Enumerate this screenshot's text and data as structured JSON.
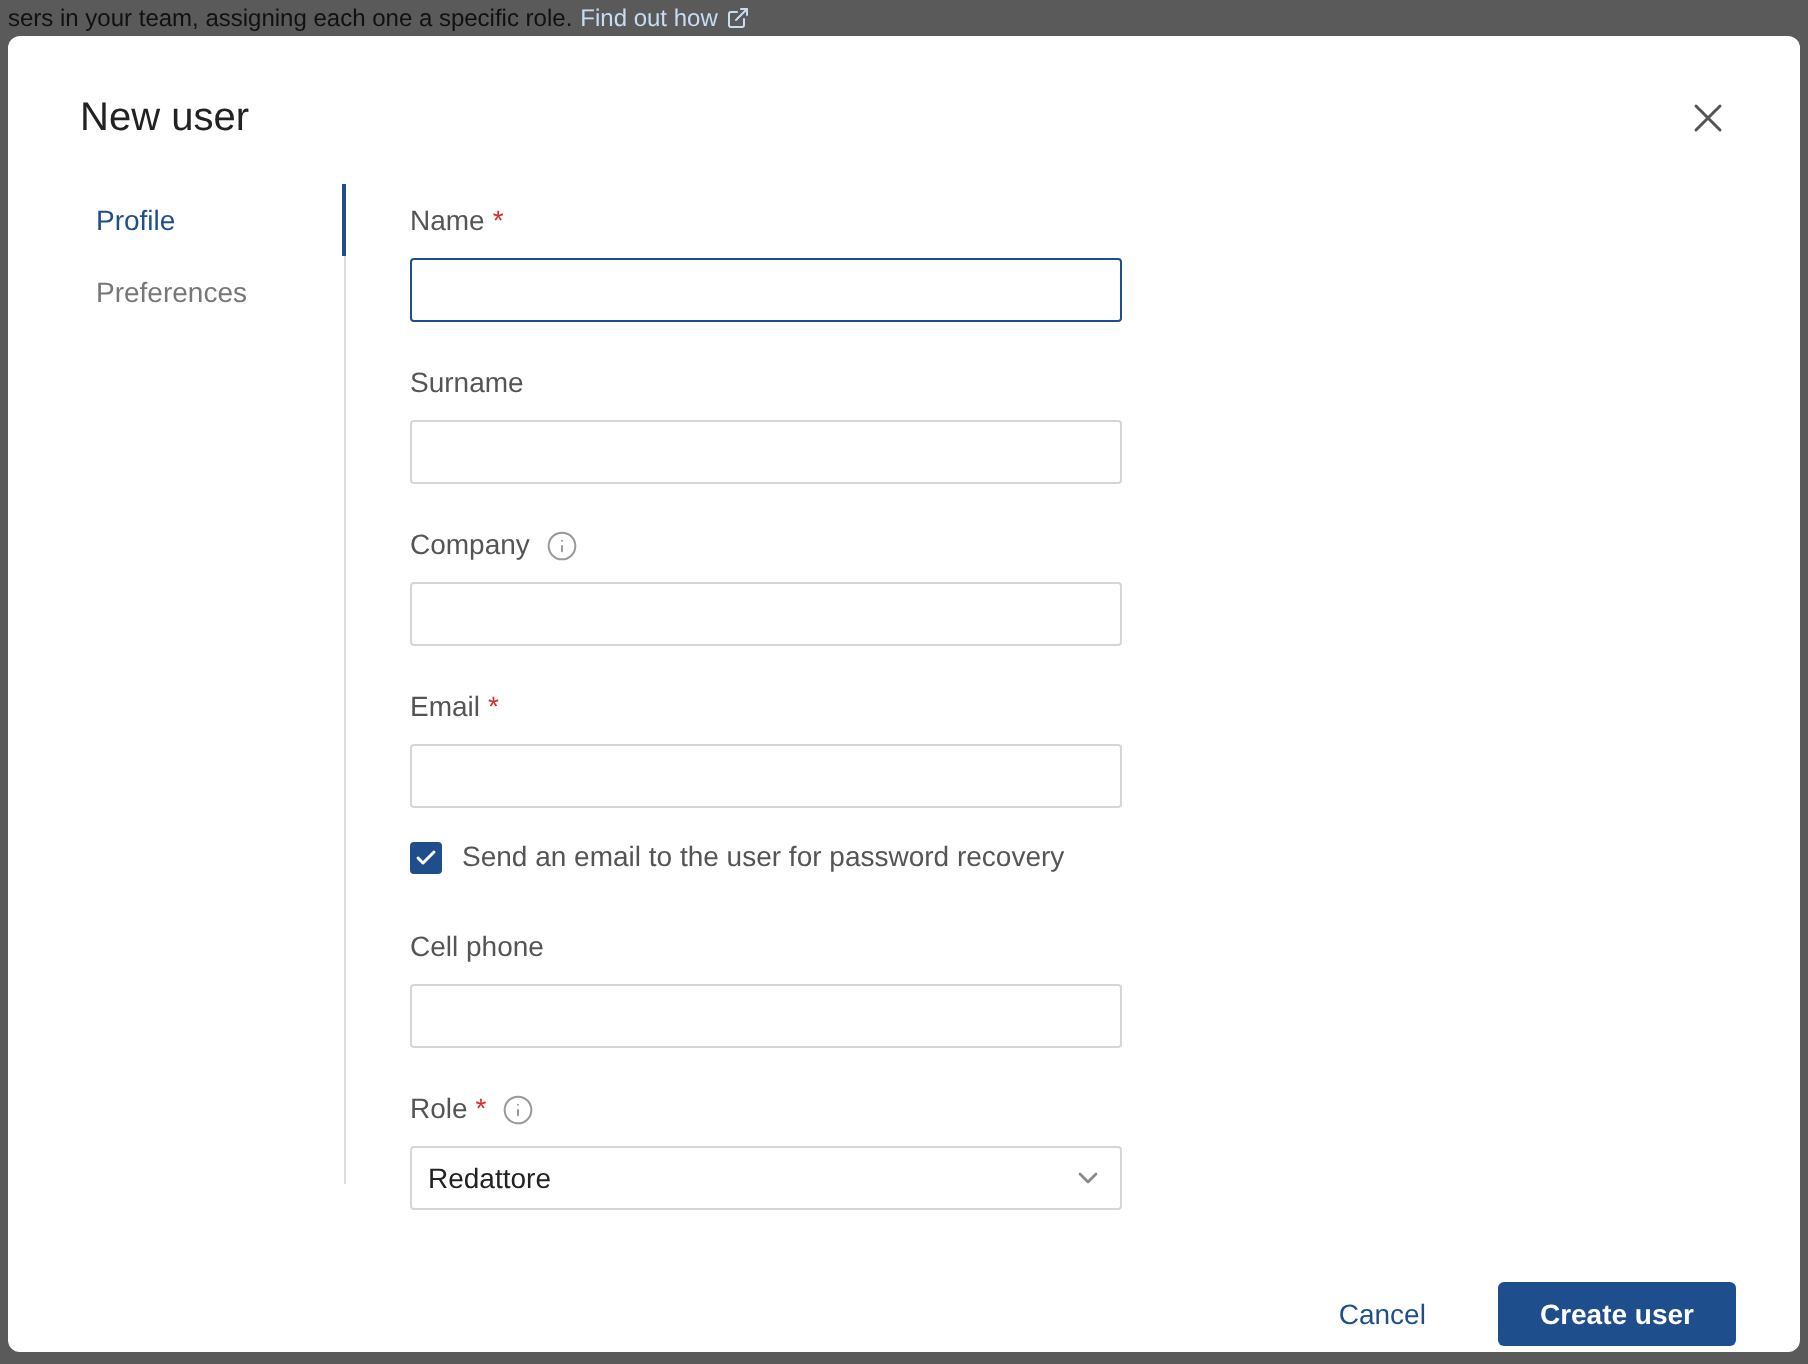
{
  "background": {
    "text": "sers in your team, assigning each one a specific role.",
    "link": "Find out how"
  },
  "dialog": {
    "title": "New user",
    "tabs": [
      {
        "label": "Profile",
        "selected": true
      },
      {
        "label": "Preferences",
        "selected": false
      }
    ],
    "fields": [
      {
        "kind": "text",
        "label": "Name",
        "marker": "*",
        "info": false,
        "focused": true
      },
      {
        "kind": "text",
        "label": "Surname",
        "info": false,
        "focused": false
      },
      {
        "kind": "text",
        "label": "Company",
        "info": true,
        "focused": false
      },
      {
        "kind": "text",
        "label": "Email",
        "marker": "*",
        "info": false,
        "focused": false
      },
      {
        "kind": "checkbox",
        "label": "Send an email to the user for password recovery",
        "checked": true
      },
      {
        "kind": "text",
        "label": "Cell phone",
        "info": false,
        "focused": false
      },
      {
        "kind": "select",
        "label": "Role",
        "marker": "*",
        "info": true,
        "value": "Redattore"
      }
    ],
    "buttons": {
      "cancel": "Cancel",
      "submit": "Create user"
    }
  }
}
